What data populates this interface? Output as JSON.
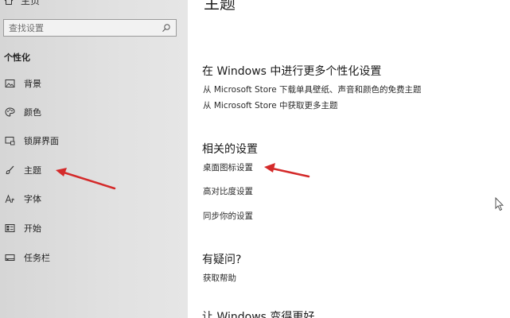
{
  "sidebar": {
    "home_label": "主页",
    "search": {
      "placeholder": "查找设置"
    },
    "section_title": "个性化",
    "items": [
      {
        "label": "背景",
        "icon": "picture-icon"
      },
      {
        "label": "颜色",
        "icon": "palette-icon"
      },
      {
        "label": "锁屏界面",
        "icon": "lock-screen-icon"
      },
      {
        "label": "主题",
        "icon": "brush-icon"
      },
      {
        "label": "字体",
        "icon": "font-icon"
      },
      {
        "label": "开始",
        "icon": "start-icon"
      },
      {
        "label": "任务栏",
        "icon": "taskbar-icon"
      }
    ]
  },
  "main": {
    "title": "主题",
    "more_personalization": {
      "heading": "在 Windows 中进行更多个性化设置",
      "links": [
        "从 Microsoft Store 下载单具壁纸、声音和颜色的免费主题",
        "从 Microsoft Store 中获取更多主题"
      ]
    },
    "related": {
      "heading": "相关的设置",
      "links": [
        "桌面图标设置",
        "高对比度设置",
        "同步你的设置"
      ]
    },
    "question": {
      "heading": "有疑问?",
      "link": "获取帮助"
    },
    "bottom_partial": "让 Windows 变得更好"
  },
  "colors": {
    "annotation_arrow": "#d42a2a",
    "sidebar_bg": "#dedede"
  }
}
